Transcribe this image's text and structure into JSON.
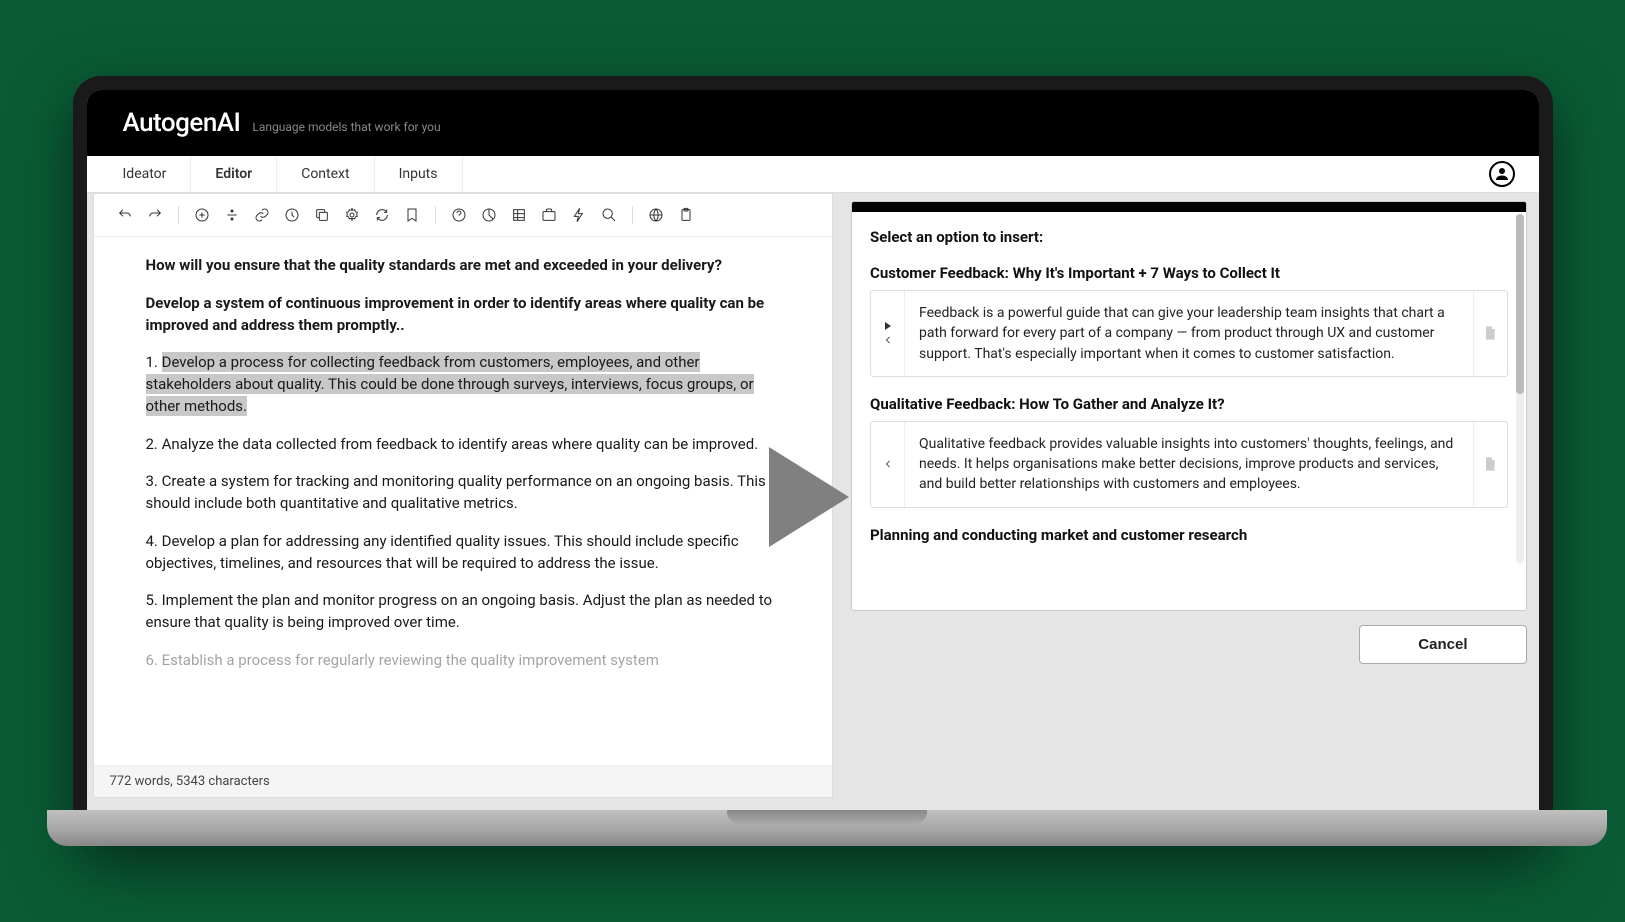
{
  "brand": {
    "name": "AutogenAI",
    "tagline": "Language models that work for you"
  },
  "tabs": [
    {
      "label": "Ideator",
      "active": false
    },
    {
      "label": "Editor",
      "active": true
    },
    {
      "label": "Context",
      "active": false
    },
    {
      "label": "Inputs",
      "active": false
    }
  ],
  "editor": {
    "heading": "How will you ensure that the quality standards are met and exceeded in your delivery?",
    "subheading": "Develop a system of continuous improvement in order to identify areas where quality can be improved and address them promptly.",
    "item1_prefix": "1. ",
    "item1_highlight": "Develop a process for collecting feedback from customers, employees, and other stakeholders about quality. This could be done through surveys, interviews, focus groups, or other methods.",
    "item2": "2. Analyze the data collected from feedback to identify areas where quality can be improved.",
    "item3": "3. Create a system for tracking and monitoring quality performance on an ongoing basis. This should include both quantitative and qualitative metrics.",
    "item4": "4. Develop a plan for addressing any identified quality issues. This should include specific objectives, timelines, and resources that will be required to address the issue.",
    "item5": "5. Implement the plan and monitor progress on an ongoing basis. Adjust the plan as needed to ensure that quality is being improved over time.",
    "item6": "6. Establish a process for regularly reviewing the quality improvement system"
  },
  "status": "772 words, 5343 characters",
  "sidepanel": {
    "prompt": "Select an option to insert:",
    "options": [
      {
        "title": "Customer Feedback: Why It's Important + 7 Ways to Collect It",
        "body": "Feedback is a powerful guide that can give your leadership team insights that chart a path forward for every part of a company — from product through UX and customer support. That's especially important when it comes to customer satisfaction."
      },
      {
        "title": "Qualitative Feedback: How To Gather and Analyze It?",
        "body": "Qualitative feedback provides valuable insights into customers' thoughts, feelings, and needs. It helps organisations make better decisions, improve products and services, and build better relationships with customers and employees."
      },
      {
        "title": "Planning and conducting market and customer research",
        "body": ""
      }
    ],
    "cancel": "Cancel"
  }
}
